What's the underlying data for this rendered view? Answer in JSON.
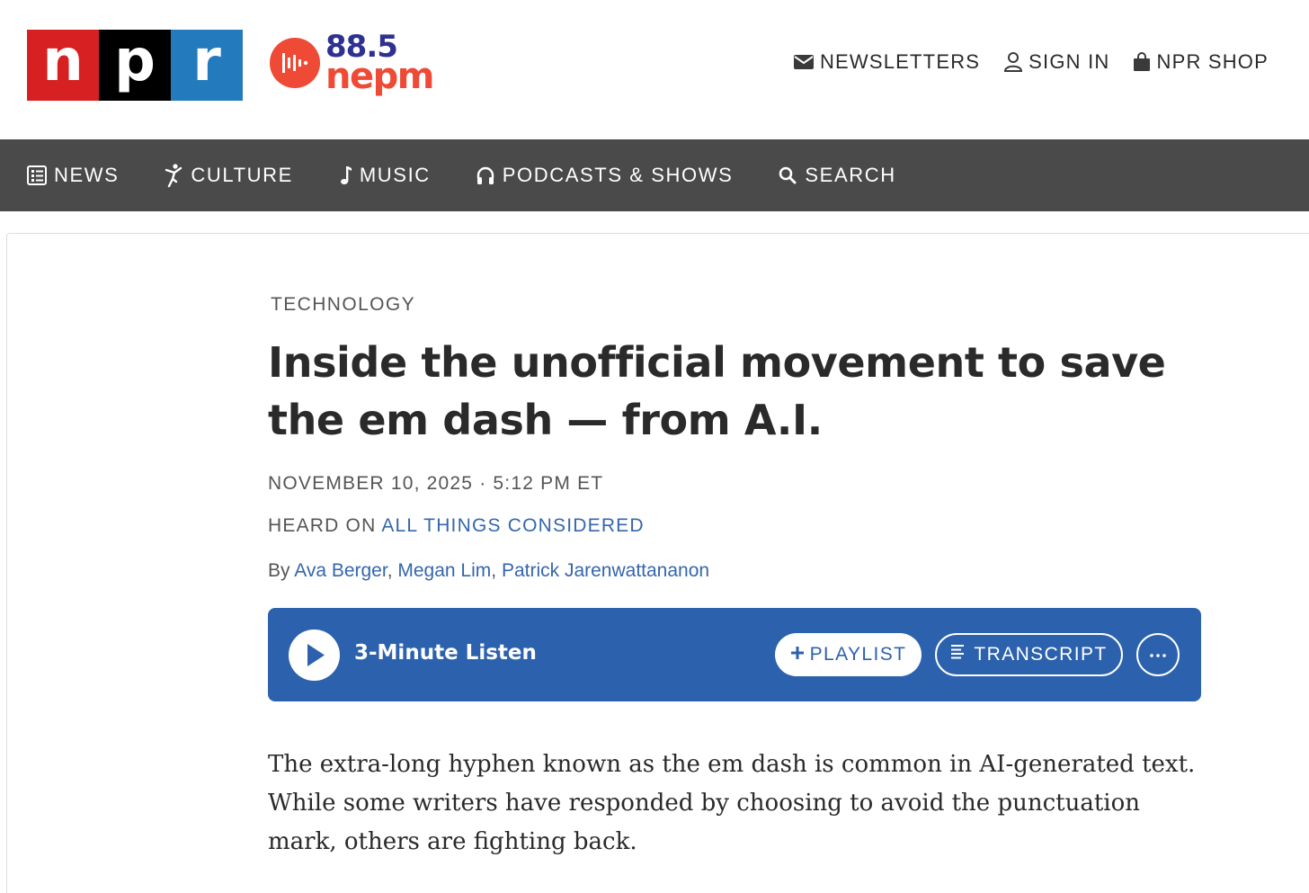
{
  "header": {
    "logo_letters": [
      "n",
      "p",
      "r"
    ],
    "station_frequency": "88.5",
    "station_call": "nepm",
    "utility": [
      {
        "label": "NEWSLETTERS",
        "icon": "envelope-icon"
      },
      {
        "label": "SIGN IN",
        "icon": "user-icon"
      },
      {
        "label": "NPR SHOP",
        "icon": "shopping-bag-icon"
      }
    ]
  },
  "nav": {
    "items": [
      {
        "label": "NEWS",
        "icon": "newspaper-icon"
      },
      {
        "label": "CULTURE",
        "icon": "dancer-icon"
      },
      {
        "label": "MUSIC",
        "icon": "music-note-icon"
      },
      {
        "label": "PODCASTS & SHOWS",
        "icon": "headphones-icon"
      },
      {
        "label": "SEARCH",
        "icon": "search-icon"
      }
    ]
  },
  "article": {
    "section": "TECHNOLOGY",
    "headline": "Inside the unofficial movement to save the em dash — from A.I.",
    "dateline": "NOVEMBER 10, 2025 · 5:12 PM ET",
    "heard_on_prefix": "HEARD ON ",
    "heard_on_show": "ALL THINGS CONSIDERED",
    "byline_prefix": "By ",
    "authors": [
      "Ava Berger",
      "Megan Lim",
      "Patrick Jarenwattananon"
    ],
    "author_separator": ", ",
    "player": {
      "listen_label": "3-Minute Listen",
      "playlist_label": "PLAYLIST",
      "transcript_label": "TRANSCRIPT"
    },
    "teaser": "The extra-long hyphen known as the em dash is common in AI-generated text. While some writers have responded by choosing to avoid the punctuation mark, others are fighting back."
  },
  "colors": {
    "npr_red": "#d62021",
    "npr_black": "#000000",
    "npr_blue": "#237bbd",
    "station_red": "#ee4a36",
    "station_navy": "#2e3191",
    "nav_background": "#4a4a4a",
    "link_blue": "#3566ad",
    "player_blue": "#2c62ad"
  }
}
